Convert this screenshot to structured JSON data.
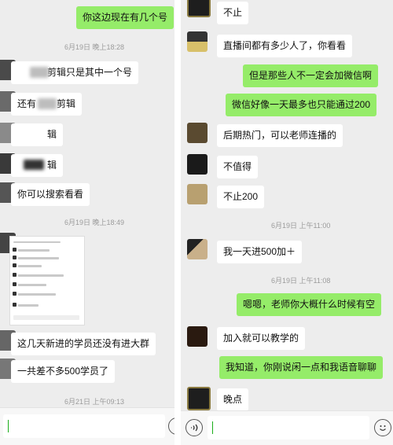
{
  "left_chat": {
    "messages": [
      {
        "text": "你这边现在有几个号"
      },
      {
        "time": "6月19日 晚上18:28"
      },
      {
        "text": "剪辑只是其中一个号"
      },
      {
        "text": "还有",
        "text2": "剪辑"
      },
      {
        "text": "辑"
      },
      {
        "text": "辑"
      },
      {
        "text": "你可以搜索看看"
      },
      {
        "time": "6月19日 晚上18:49"
      },
      {
        "text": "这几天新进的学员还没有进大群"
      },
      {
        "text": "一共差不多500学员了"
      },
      {
        "time": "6月21日 上午09:13"
      }
    ]
  },
  "right_chat": {
    "messages": [
      {
        "text": "不止"
      },
      {
        "text": "直播间都有多少人了，你看看"
      },
      {
        "text": "但是那些人不一定会加微信啊"
      },
      {
        "text": "微信好像一天最多也只能通过200"
      },
      {
        "text": "后期热门，可以老师连播的"
      },
      {
        "text": "不值得"
      },
      {
        "text": "不止200"
      },
      {
        "time": "6月19日 上午11:00"
      },
      {
        "text": "我一天进500加＋"
      },
      {
        "time": "6月19日 上午11:08"
      },
      {
        "text": "嗯嗯，老师你大概什么时候有空"
      },
      {
        "text": "加入就可以教学的"
      },
      {
        "text": "我知道，你刚说闲一点和我语音聊聊"
      },
      {
        "text": "晚点"
      }
    ]
  },
  "icons": {
    "voice": "voice-icon",
    "emoji": "emoji-icon"
  },
  "colors": {
    "chat_bg": "#ededed",
    "outgoing": "#95ec69",
    "incoming": "#ffffff",
    "caret": "#1aad19"
  }
}
